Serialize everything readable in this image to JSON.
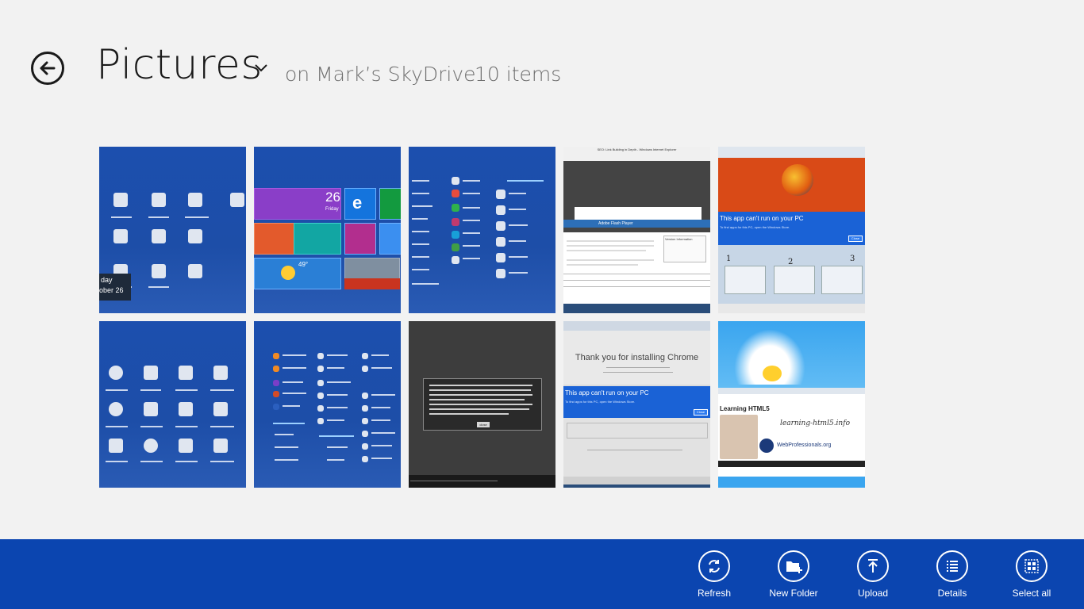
{
  "header": {
    "title": "Pictures",
    "location": "on Mark’s SkyDrive",
    "count": "10 items"
  },
  "thumbnails": [
    {
      "label_a": "day",
      "label_b": "ober 26"
    },
    {
      "tile_number": "26",
      "tile_day": "Friday",
      "tile_weather": "49°"
    },
    {},
    {
      "window_title": "SEO: Link Building in Depth - Windows Internet Explorer",
      "dialog_title": "Adobe Flash Player",
      "info_title": "Version Information"
    },
    {
      "banner": "This app can't run on your PC",
      "banner_sub": "To find apps for this PC, open the Windows Store.",
      "close": "Close",
      "n1": "1",
      "n2": "2",
      "n3": "3"
    },
    {},
    {},
    {
      "close": "close"
    },
    {
      "heading": "Thank you for installing Chrome",
      "banner": "This app can't run on your PC",
      "banner_sub": "To find apps for this PC, open the Windows Store.",
      "close": "Close"
    },
    {
      "heading": "Learning HTML5",
      "site": "learning-html5.info",
      "brand": "WebProfessionals.org"
    }
  ],
  "appbar": {
    "buttons": [
      {
        "label": "Refresh",
        "icon": "refresh-icon"
      },
      {
        "label": "New Folder",
        "icon": "new-folder-icon"
      },
      {
        "label": "Upload",
        "icon": "upload-icon"
      },
      {
        "label": "Details",
        "icon": "details-icon"
      },
      {
        "label": "Select all",
        "icon": "select-all-icon"
      }
    ]
  },
  "colors": {
    "background": "#f2f2f2",
    "appbar": "#0b45b0",
    "start_blue": "#1c4fae"
  }
}
